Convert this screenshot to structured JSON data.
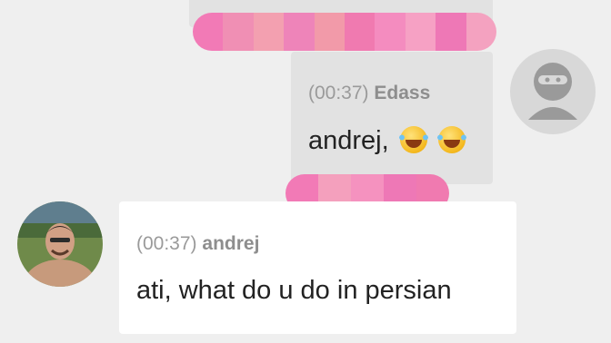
{
  "colors": {
    "background": "#efefef",
    "own_bubble": "#e2e2e2",
    "other_bubble": "#ffffff",
    "redaction": "#f07ab0"
  },
  "messages": [
    {
      "time": "(00:37)",
      "sender": "Edass",
      "text": "andrej,",
      "emojis": [
        "face-with-tears-of-joy-icon",
        "face-with-tears-of-joy-icon"
      ],
      "avatar": "ninja-avatar-icon"
    },
    {
      "time": "(00:37)",
      "sender": "andrej",
      "text": "ati, what do u do in persian",
      "avatar": "user-photo-avatar"
    }
  ]
}
